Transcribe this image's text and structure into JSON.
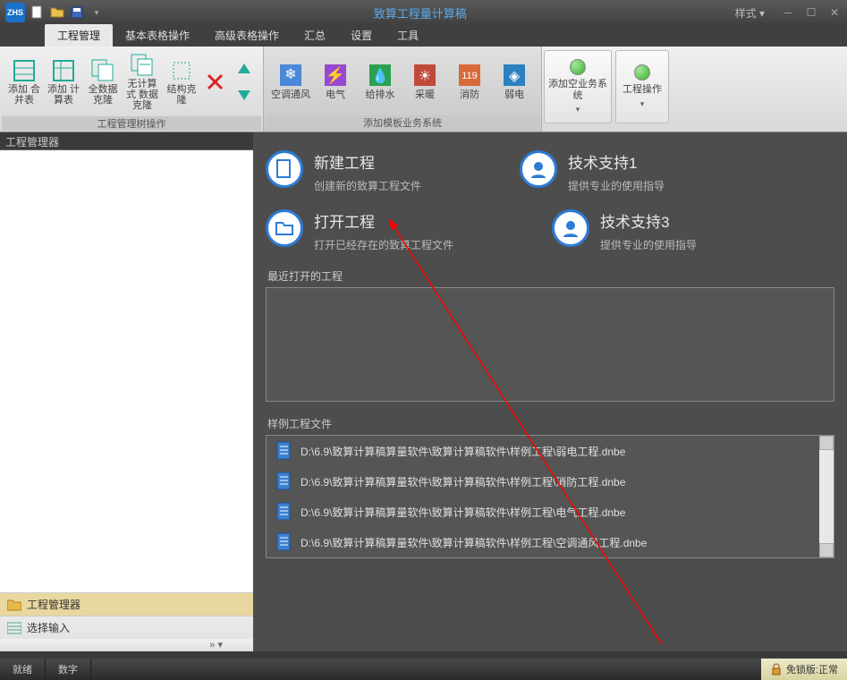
{
  "titlebar": {
    "title": "致算工程量计算稿",
    "style_label": "样式"
  },
  "menutabs": [
    "工程管理",
    "基本表格操作",
    "高级表格操作",
    "汇总",
    "设置",
    "工具"
  ],
  "ribbon": {
    "group1": {
      "label": "工程管理树操作",
      "items": [
        "添加\n合并表",
        "添加\n计算表",
        "全数据\n克隆",
        "无计算式\n数据克隆",
        "结构克隆"
      ]
    },
    "group2": {
      "label": "添加模板业务系统",
      "items": [
        "空调通风",
        "电气",
        "给排水",
        "采暖",
        "消防",
        "弱电"
      ]
    },
    "side1": "添加空业务系统",
    "side2": "工程操作"
  },
  "left_panel": {
    "title": "工程管理器",
    "bottom1": "工程管理器",
    "bottom2": "选择输入"
  },
  "start": {
    "card1": {
      "title": "新建工程",
      "sub": "创建新的致算工程文件"
    },
    "card2": {
      "title": "技术支持1",
      "sub": "提供专业的使用指导"
    },
    "card3": {
      "title": "打开工程",
      "sub": "打开已经存在的致算工程文件"
    },
    "card4": {
      "title": "技术支持3",
      "sub": "提供专业的使用指导"
    },
    "recent_label": "最近打开的工程",
    "sample_label": "样例工程文件",
    "samples": [
      "D:\\6.9\\致算计算稿算量软件\\致算计算稿软件\\样例工程\\弱电工程.dnbe",
      "D:\\6.9\\致算计算稿算量软件\\致算计算稿软件\\样例工程\\消防工程.dnbe",
      "D:\\6.9\\致算计算稿算量软件\\致算计算稿软件\\样例工程\\电气工程.dnbe",
      "D:\\6.9\\致算计算稿算量软件\\致算计算稿软件\\样例工程\\空调通风工程.dnbe"
    ]
  },
  "status": {
    "ready": "就绪",
    "num": "数字",
    "lock": "免锁版:正常"
  }
}
